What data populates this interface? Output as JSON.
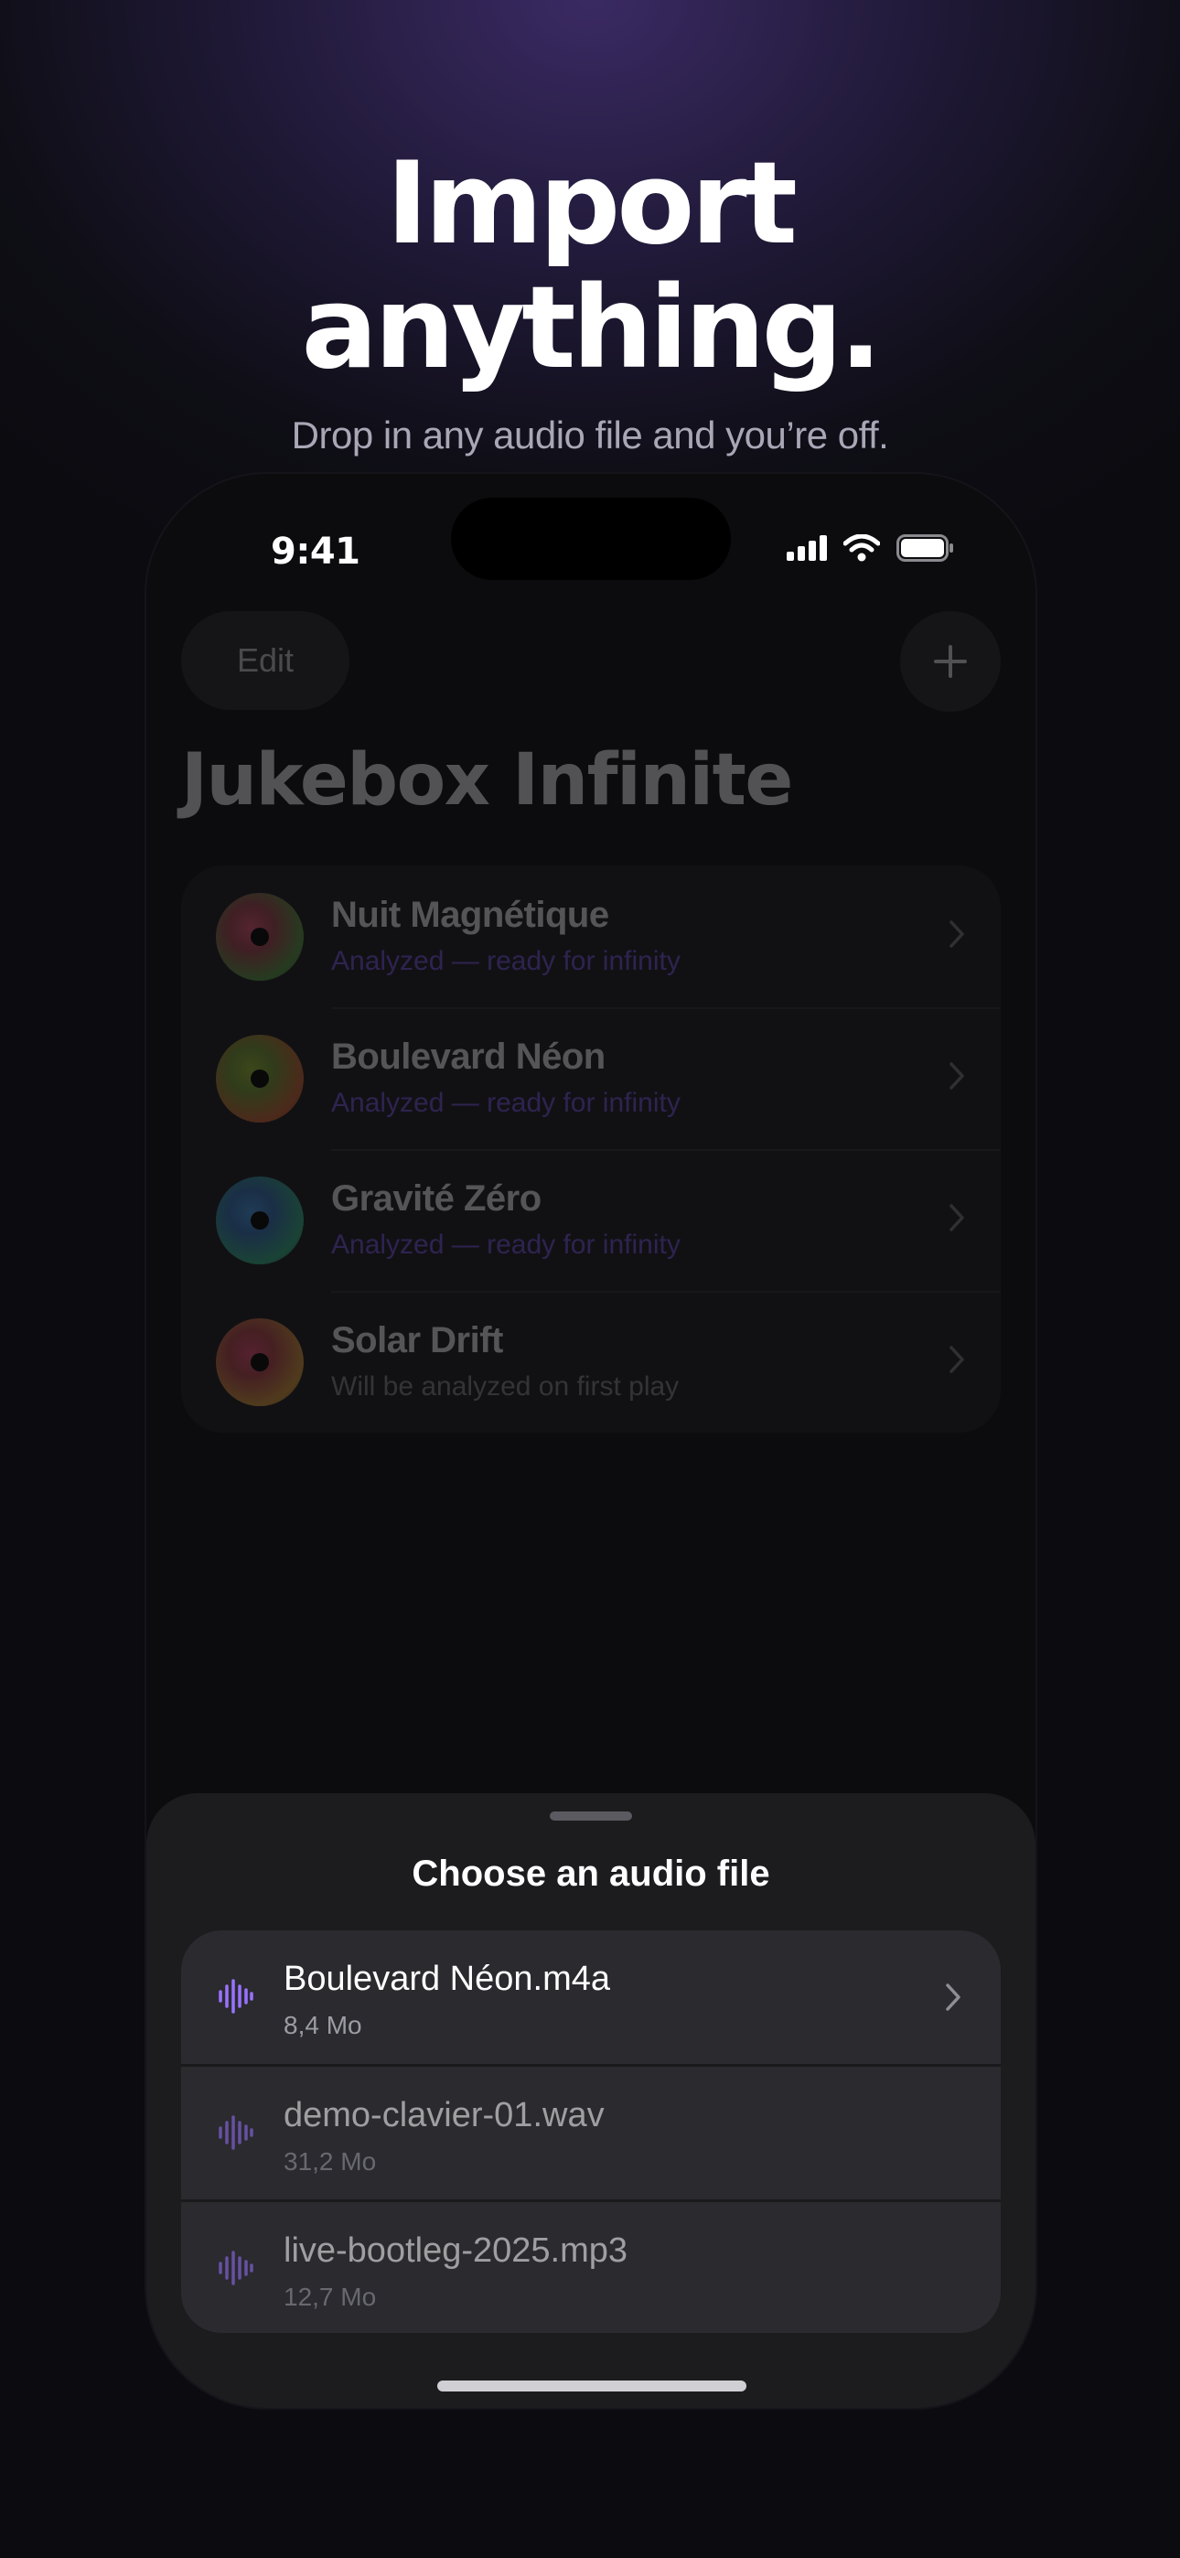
{
  "promo": {
    "headline_line1": "Import",
    "headline_line2": "anything.",
    "subtitle": "Drop in any audio file and you’re off."
  },
  "status_bar": {
    "time": "9:41",
    "icons": [
      "cellular-signal-icon",
      "wifi-icon",
      "battery-icon"
    ]
  },
  "toolbar": {
    "edit_label": "Edit",
    "add_icon": "plus-icon"
  },
  "app": {
    "title": "Jukebox Infinite"
  },
  "library": {
    "tracks": [
      {
        "title": "Nuit Magnétique",
        "status": "Analyzed — ready for infinity"
      },
      {
        "title": "Boulevard Néon",
        "status": "Analyzed — ready for infinity"
      },
      {
        "title": "Gravité Zéro",
        "status": "Analyzed — ready for infinity"
      },
      {
        "title": "Solar Drift",
        "status": "Will be analyzed on first play"
      }
    ]
  },
  "sheet": {
    "title": "Choose an audio file",
    "files": [
      {
        "name": "Boulevard Néon.m4a",
        "size": "8,4 Mo"
      },
      {
        "name": "demo-clavier-01.wav",
        "size": "31,2 Mo"
      },
      {
        "name": "live-bootleg-2025.mp3",
        "size": "12,7 Mo"
      }
    ]
  },
  "colors": {
    "accent": "#7b55e0",
    "background": "#0f0e16",
    "sheet": "#1c1c1f"
  }
}
